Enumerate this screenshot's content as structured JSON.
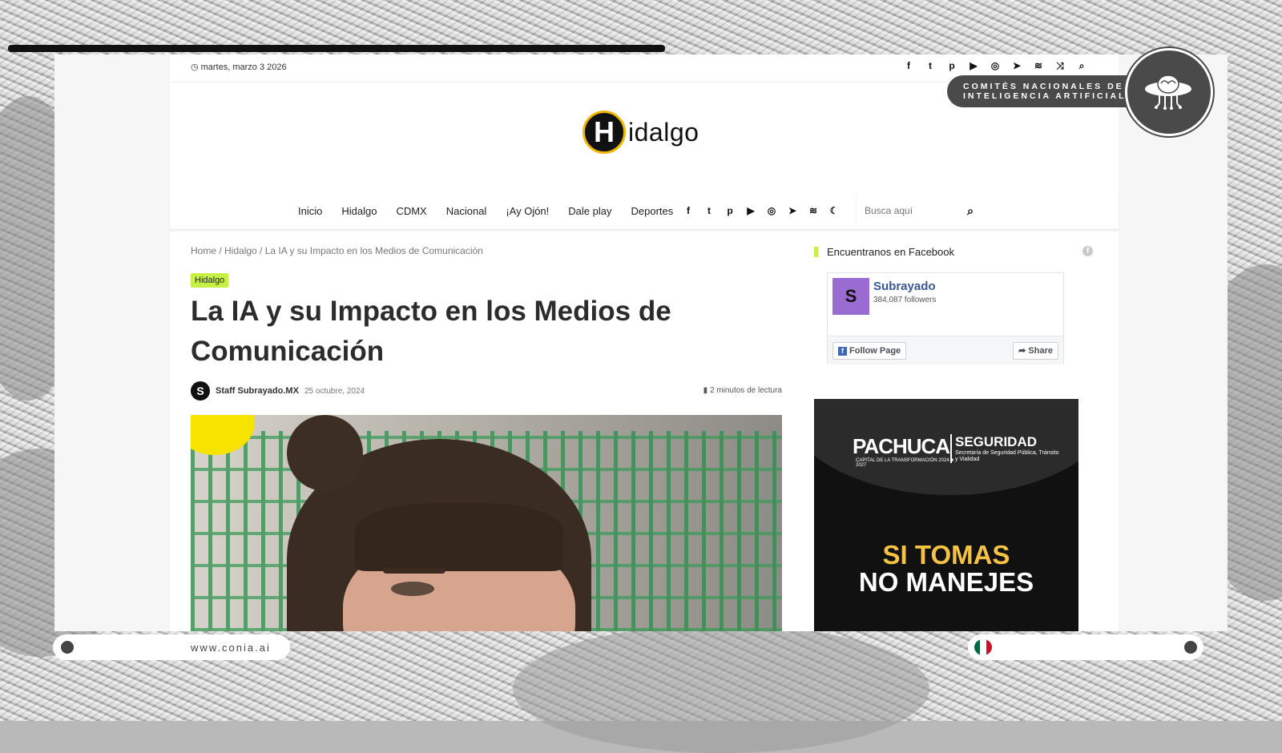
{
  "topbar": {
    "date": "martes, marzo 3 2026",
    "social_icons": [
      "facebook-icon",
      "twitter-icon",
      "pinterest-icon",
      "youtube-icon",
      "instagram-icon",
      "telegram-icon",
      "rss-icon",
      "random-icon",
      "search-icon"
    ]
  },
  "logo": {
    "letter": "H",
    "text": "idalgo"
  },
  "nav": {
    "items": [
      "Inicio",
      "Hidalgo",
      "CDMX",
      "Nacional",
      "¡Ay Ojón!",
      "Dale play",
      "Deportes"
    ],
    "search_placeholder": "Busca aquí"
  },
  "article": {
    "breadcrumb": "Home / Hidalgo / La IA y su Impacto en los Medios de Comunicación",
    "category": "Hidalgo",
    "title": "La IA y su Impacto en los Medios de Comunicación",
    "author_initial": "S",
    "author": "Staff Subrayado.MX",
    "date": "25 octubre, 2024",
    "read_time": "2 minutos de lectura"
  },
  "sidebar": {
    "widget_title": "Encuentranos en Facebook",
    "fb": {
      "name": "Subrayado",
      "followers": "384,087 followers",
      "follow_label": "Follow Page",
      "share_label": "Share"
    },
    "ad": {
      "brand": "PACHUCA",
      "brand_sub": "CAPITAL DE LA TRANSFORMACIÓN 2024 ■ 2027",
      "segment": "SEGURIDAD",
      "segment_sub": "Secretaría de Seguridad Pública, Tránsito y Vialidad",
      "line1": "SI TOMAS",
      "line2": "NO MANEJES"
    }
  },
  "overlay": {
    "badge_line1": "COMITÉS NACIONALES DE",
    "badge_line2": "INTELIGENCIA ARTIFICIAL",
    "url": "www.conia.ai"
  },
  "colors": {
    "accent": "#c6f042",
    "fb_blue": "#385898",
    "badge_grey": "#4a4a4a",
    "ad_yellow": "#f5c243"
  }
}
